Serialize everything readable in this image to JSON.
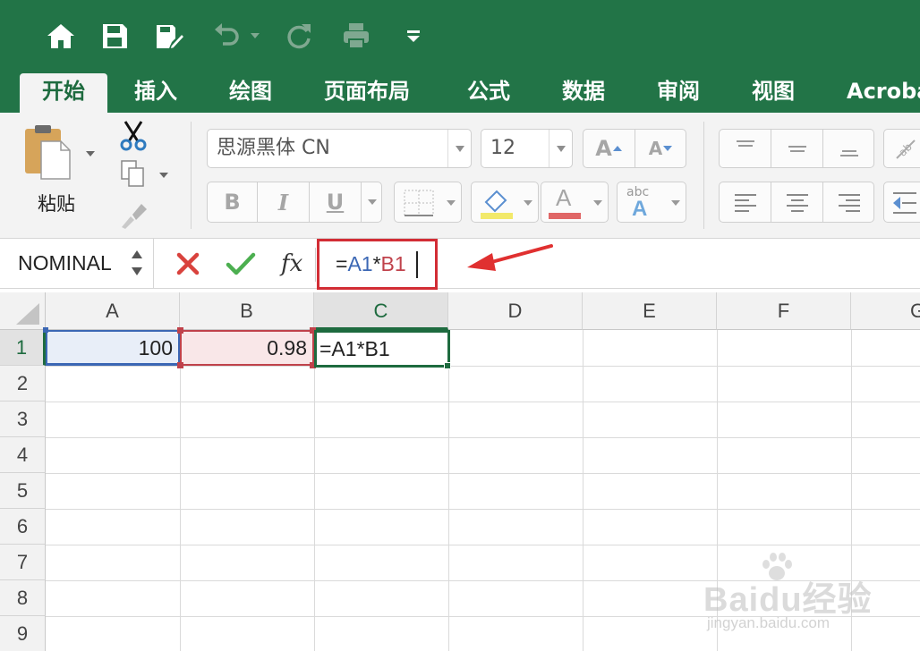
{
  "quick_access": {
    "icons": [
      "home-icon",
      "save-icon",
      "edit-save-icon",
      "undo-icon",
      "redo-icon",
      "print-icon",
      "customize-dropdown-icon"
    ]
  },
  "tabs": [
    {
      "label": "开始",
      "active": true
    },
    {
      "label": "插入"
    },
    {
      "label": "绘图"
    },
    {
      "label": "页面布局"
    },
    {
      "label": "公式"
    },
    {
      "label": "数据"
    },
    {
      "label": "审阅"
    },
    {
      "label": "视图"
    },
    {
      "label": "Acroba"
    }
  ],
  "ribbon": {
    "paste_label": "粘贴",
    "font_name": "思源黑体 CN",
    "font_size": "12",
    "grow_font": "A",
    "shrink_font": "A",
    "bold": "B",
    "italic": "I",
    "underline": "U",
    "font_color_letter": "A",
    "abc_label": "abc",
    "abc_letter": "A",
    "colors": {
      "highlight": "#f2e96a",
      "font_color": "#e06666",
      "abc_blue": "#6fa8dc"
    }
  },
  "formula_bar": {
    "name_box": "NOMINAL",
    "fx_label": "fx",
    "formula_eq": "=",
    "formula_a1": "A1",
    "formula_op": "*",
    "formula_b1": "B1",
    "highlight_color": "#d22d35"
  },
  "grid": {
    "columns": [
      "A",
      "B",
      "C",
      "D",
      "E",
      "F",
      "G"
    ],
    "rows": [
      "1",
      "2",
      "3",
      "4",
      "5",
      "6",
      "7",
      "8",
      "9"
    ],
    "cells": {
      "A1": "100",
      "B1": "0.98",
      "C1": "=A1*B1"
    },
    "ref_colors": {
      "A1": "#3b67b4",
      "B1": "#c0424b",
      "active": "#1e6b3f"
    }
  },
  "watermark": {
    "logo": "Baidu经验",
    "url": "jingyan.baidu.com"
  }
}
